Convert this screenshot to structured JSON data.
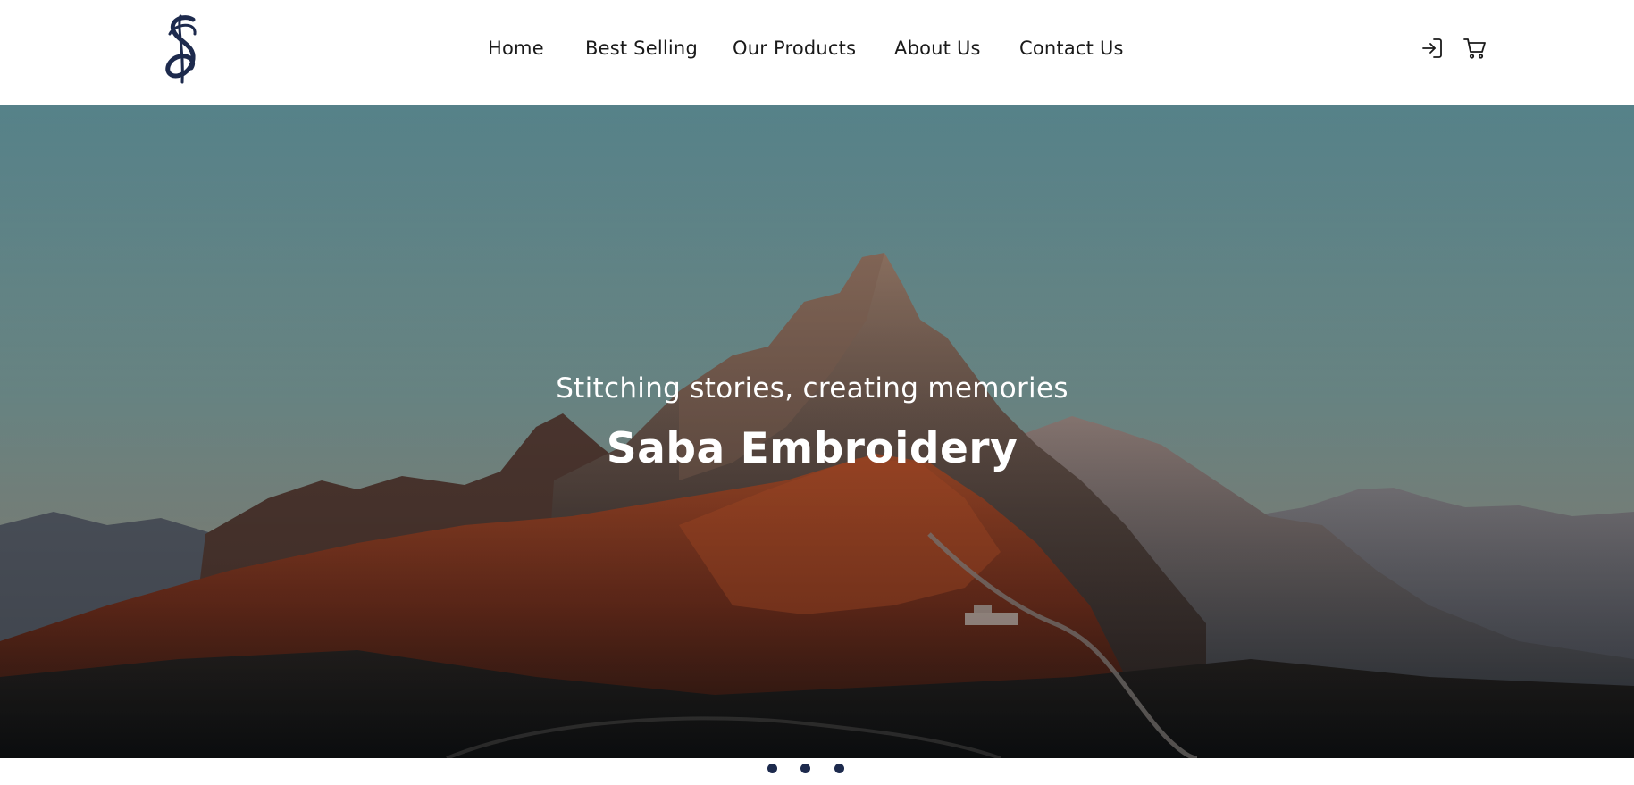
{
  "header": {
    "logo_icon": "script-s-logo-icon",
    "nav": {
      "home": "Home",
      "best_selling": "Best Selling",
      "our_products": "Our Products",
      "about_us": "About Us",
      "contact_us": "Contact Us"
    },
    "icons": {
      "login": "login-icon",
      "cart": "cart-icon"
    }
  },
  "hero": {
    "subtitle": "Stitching stories, creating memories",
    "title": "Saba Embroidery",
    "background_image": "mountain-landscape-image"
  },
  "carousel": {
    "dot_count": 3,
    "dot_color": "#1d2a4d"
  },
  "colors": {
    "brand_navy": "#1d2a4d",
    "nav_text": "#1a1a1a",
    "hero_text": "#ffffff"
  }
}
